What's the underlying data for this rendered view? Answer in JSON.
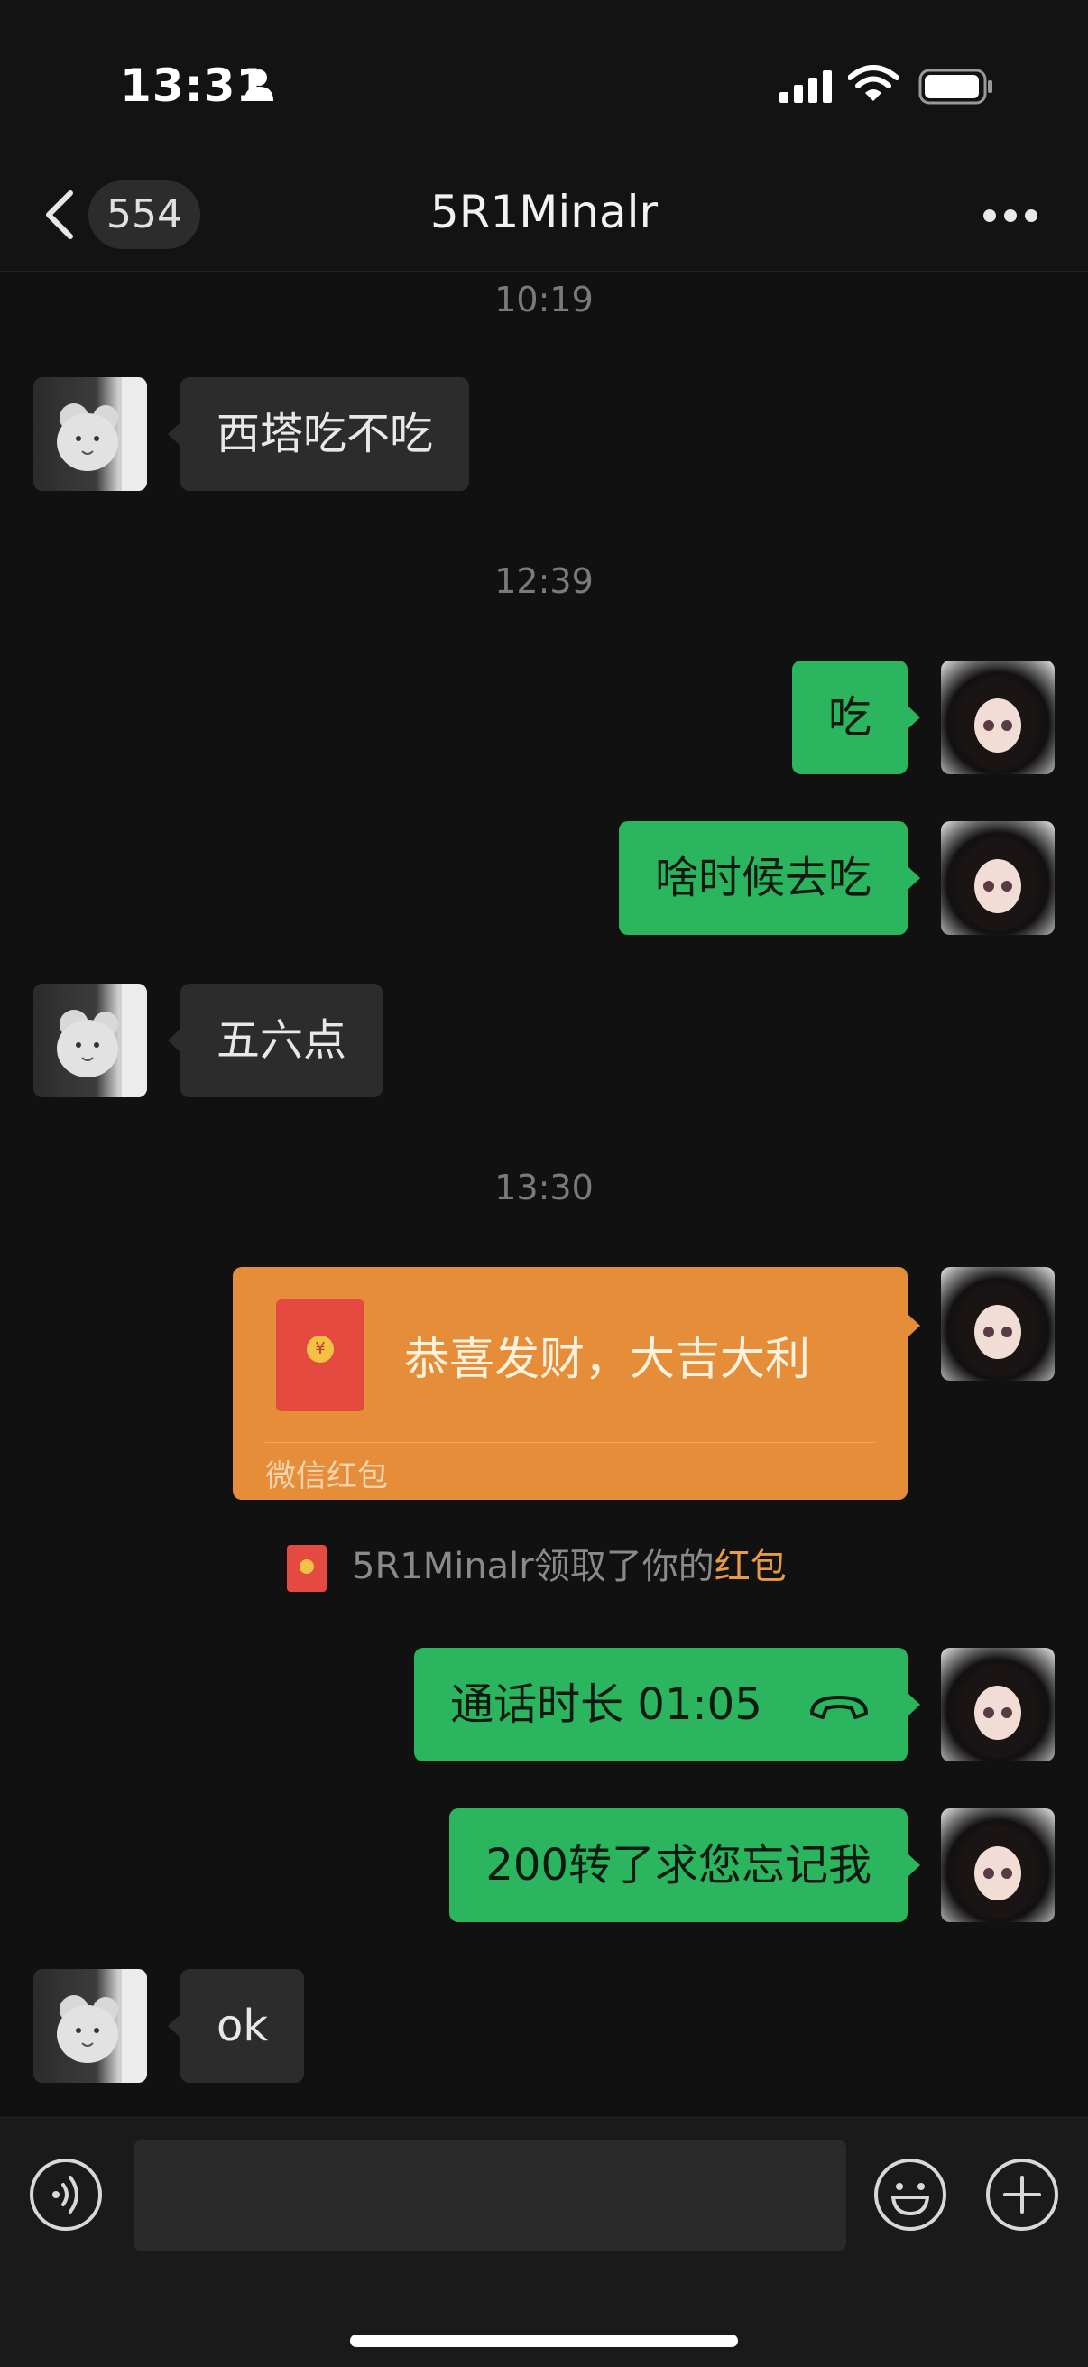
{
  "status_bar": {
    "time": "13:31"
  },
  "nav": {
    "badge_count": "554",
    "title": "5R1Minalr"
  },
  "messages": [
    {
      "type": "timestamp",
      "text": "10:19"
    },
    {
      "type": "incoming",
      "text": "西塔吃不吃"
    },
    {
      "type": "timestamp",
      "text": "12:39"
    },
    {
      "type": "outgoing",
      "text": "吃"
    },
    {
      "type": "outgoing",
      "text": "啥时候去吃"
    },
    {
      "type": "incoming",
      "text": "五六点"
    },
    {
      "type": "timestamp",
      "text": "13:30"
    },
    {
      "type": "red_packet",
      "title": "恭喜发财，大吉大利",
      "footer": "微信红包"
    },
    {
      "type": "system",
      "name": "5R1Minalr",
      "text": "领取了你的",
      "link": "红包"
    },
    {
      "type": "outgoing",
      "text": "通话时长 01:05",
      "icon": "phone-hangup-icon"
    },
    {
      "type": "outgoing",
      "text": "200转了求您忘记我"
    },
    {
      "type": "incoming",
      "text": "ok"
    }
  ],
  "input": {
    "placeholder": ""
  },
  "colors": {
    "outgoing": "#2ab55e",
    "incoming": "#2c2c2c",
    "red_packet": "#e58d38",
    "link": "#e99a45"
  }
}
